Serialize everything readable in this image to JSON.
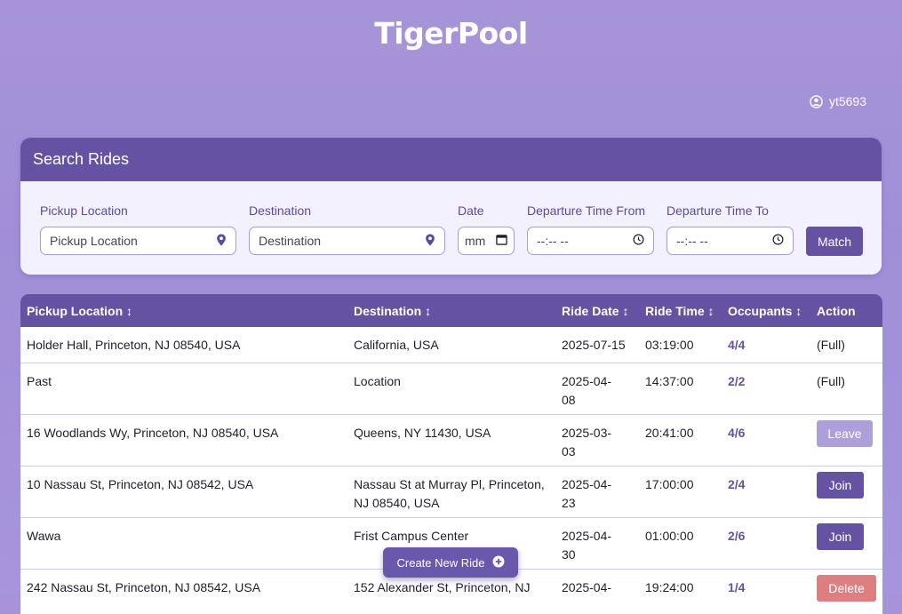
{
  "app": {
    "title": "TigerPool"
  },
  "user": {
    "username": "yt5693",
    "icon": "user-circle-icon"
  },
  "search": {
    "heading": "Search Rides",
    "pickup_label": "Pickup Location",
    "pickup_placeholder": "Pickup Location",
    "destination_label": "Destination",
    "destination_placeholder": "Destination",
    "date_label": "Date",
    "date_value": "mm",
    "time_from_label": "Departure Time From",
    "time_from_value": "--:-- --",
    "time_to_label": "Departure Time To",
    "time_to_value": "--:-- --",
    "match_label": "Match"
  },
  "table": {
    "headers": [
      "Pickup Location ↕",
      "Destination ↕",
      "Ride Date ↕",
      "Ride Time ↕",
      "Occupants ↕",
      "Action"
    ],
    "rows": [
      {
        "pickup": "Holder Hall, Princeton, NJ 08540, USA",
        "destination": "California, USA",
        "date": "2025-07-15",
        "time": "03:19:00",
        "occupants": "4/4",
        "action": "(Full)"
      },
      {
        "pickup": "Past",
        "destination": "Location",
        "date": "2025-04-08",
        "time": "14:37:00",
        "occupants": "2/2",
        "action": "(Full)"
      },
      {
        "pickup": "16 Woodlands Wy, Princeton, NJ 08540, USA",
        "destination": "Queens, NY 11430, USA",
        "date": "2025-03-03",
        "time": "20:41:00",
        "occupants": "4/6",
        "action": "Leave"
      },
      {
        "pickup": "10 Nassau St, Princeton, NJ 08542, USA",
        "destination": "Nassau St at Murray Pl, Princeton, NJ 08540, USA",
        "date": "2025-04-23",
        "time": "17:00:00",
        "occupants": "2/4",
        "action": "Join"
      },
      {
        "pickup": "Wawa",
        "destination": "Frist Campus Center",
        "date": "2025-04-30",
        "time": "01:00:00",
        "occupants": "2/6",
        "action": "Join"
      },
      {
        "pickup": "242 Nassau St, Princeton, NJ 08542, USA",
        "destination": "152 Alexander St, Princeton, NJ",
        "date": "2025-04-",
        "time": "19:24:00",
        "occupants": "1/4",
        "action": "Delete"
      }
    ]
  },
  "create_ride": {
    "label": "Create New Ride",
    "icon": "plus-circle-icon"
  },
  "colors": {
    "primary": "#6552a3",
    "background": "#a794d8",
    "leave": "#ac9fda",
    "delete": "#dd7f80"
  }
}
